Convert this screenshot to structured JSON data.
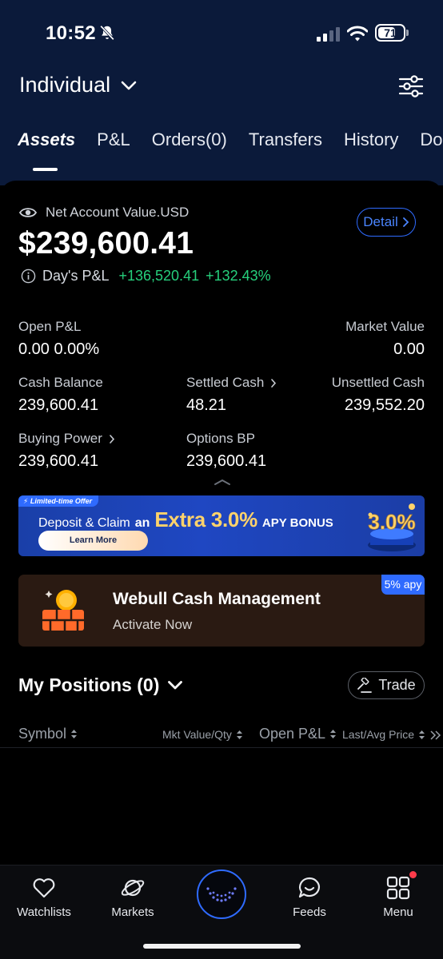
{
  "status_bar": {
    "time": "10:52",
    "battery": "71",
    "battery_level": 0.71
  },
  "header": {
    "account_name": "Individual",
    "tabs": [
      "Assets",
      "P&L",
      "Orders(0)",
      "Transfers",
      "History",
      "Do"
    ],
    "active_tab": "Assets"
  },
  "summary": {
    "nav_label": "Net Account Value.USD",
    "nav_value": "$239,600.41",
    "detail_label": "Detail",
    "days_pl_label": "Day's P&L",
    "days_pl_value": "+136,520.41",
    "days_pl_pct": "+132.43%"
  },
  "metrics": {
    "open_pl": {
      "label": "Open P&L",
      "value": "0.00 0.00%"
    },
    "market_value": {
      "label": "Market Value",
      "value": "0.00"
    },
    "cash_balance": {
      "label": "Cash Balance",
      "value": "239,600.41"
    },
    "settled_cash": {
      "label": "Settled Cash",
      "value": "48.21"
    },
    "unsettled_cash": {
      "label": "Unsettled Cash",
      "value": "239,552.20"
    },
    "buying_power": {
      "label": "Buying Power",
      "value": "239,600.41"
    },
    "options_bp": {
      "label": "Options BP",
      "value": "239,600.41"
    }
  },
  "promo": {
    "ribbon": "Limited-time Offer",
    "text_part1": "Deposit & Claim",
    "text_part2": "an",
    "text_part3": "Extra 3.0%",
    "text_part4": "APY BONUS",
    "cta": "Learn More",
    "badge": "3.0%"
  },
  "cash_management": {
    "badge": "5% apy",
    "title": "Webull Cash Management",
    "subtitle": "Activate Now"
  },
  "positions": {
    "title": "My Positions (0)",
    "trade_label": "Trade",
    "columns": [
      "Symbol",
      "Mkt Value/Qty",
      "Open P&L",
      "Last/Avg Price"
    ]
  },
  "bottom_nav": {
    "watchlists": "Watchlists",
    "markets": "Markets",
    "feeds": "Feeds",
    "menu": "Menu"
  },
  "colors": {
    "header_bg": "#0b1a3a",
    "accent_blue": "#2f6bff",
    "gain_green": "#26d07c",
    "notification_red": "#ff3b4a"
  }
}
